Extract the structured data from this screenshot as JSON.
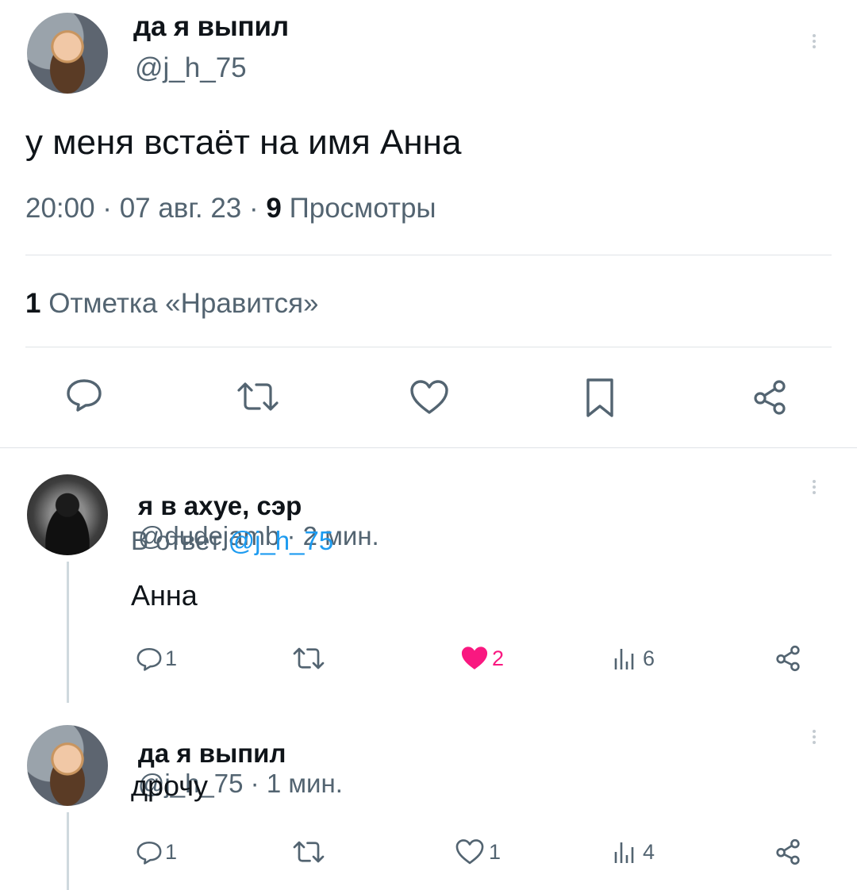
{
  "tweet": {
    "author_name": "да я выпил",
    "author_handle": "@j_h_75",
    "text": "у меня встаёт на имя Анна",
    "time": "20:00 · 07 авг. 23 · ",
    "views_count": "9",
    "views_label": " Просмотры",
    "likes_count": "1",
    "likes_label": " Отметка «Нравится»"
  },
  "replies": [
    {
      "author_name": "я в ахуе, сэр",
      "author_handle": "@dudejamb",
      "time": " · 2 мин.",
      "reply_to_prefix": "В ответ ",
      "reply_to_handle": "@j_h_75",
      "text": "Анна",
      "comments": "1",
      "likes": "2",
      "views": "6",
      "liked": true
    },
    {
      "author_name": "да я выпил",
      "author_handle": "@j_h_75",
      "time": " · 1 мин.",
      "text": "дрочу",
      "comments": "1",
      "likes": "1",
      "views": "4",
      "liked": false
    }
  ],
  "colors": {
    "text": "#0f1419",
    "secondary": "#536471",
    "link": "#1d9bf0",
    "like_active": "#f91880",
    "divider": "#dfe3e7"
  },
  "icons": [
    "comment-icon",
    "retweet-icon",
    "like-icon",
    "bookmark-icon",
    "share-icon",
    "views-icon",
    "more-icon"
  ]
}
